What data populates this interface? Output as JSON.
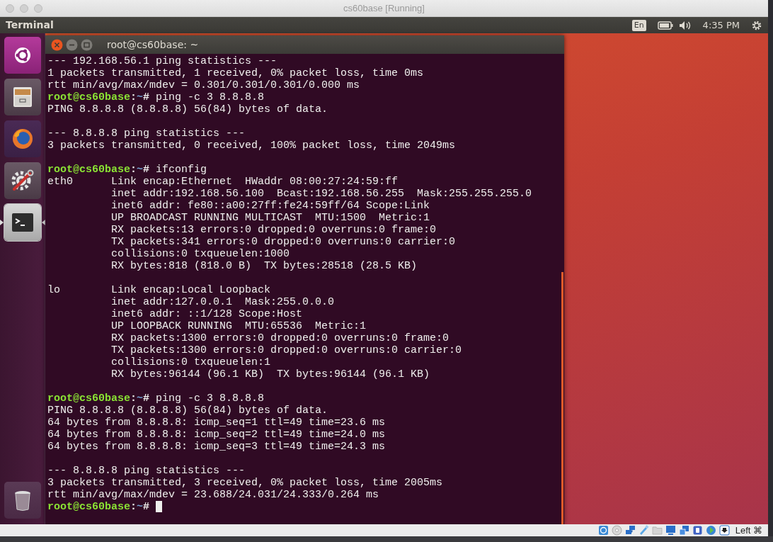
{
  "window": {
    "title": "cs60base [Running]"
  },
  "top_panel": {
    "app_name": "Terminal",
    "keyboard_layout": "En",
    "clock": "4:35 PM"
  },
  "launcher": {
    "items": [
      {
        "kind": "dash",
        "focused": false
      },
      {
        "kind": "files",
        "focused": false
      },
      {
        "kind": "browser",
        "focused": false
      },
      {
        "kind": "settings",
        "focused": false
      },
      {
        "kind": "terminal",
        "focused": true
      },
      {
        "kind": "trash",
        "focused": false
      }
    ]
  },
  "terminal": {
    "title": "root@cs60base: ~",
    "lines": [
      {
        "kind": "output",
        "text": "--- 192.168.56.1 ping statistics ---"
      },
      {
        "kind": "output",
        "text": "1 packets transmitted, 1 received, 0% packet loss, time 0ms"
      },
      {
        "kind": "output",
        "text": "rtt min/avg/max/mdev = 0.301/0.301/0.301/0.000 ms"
      },
      {
        "kind": "prompt",
        "user": "root@cs60base",
        "sep": ":",
        "path": "~",
        "symbol": "#",
        "command": "ping -c 3 8.8.8.8",
        "cursor": false
      },
      {
        "kind": "output",
        "text": "PING 8.8.8.8 (8.8.8.8) 56(84) bytes of data."
      },
      {
        "kind": "blank"
      },
      {
        "kind": "output",
        "text": "--- 8.8.8.8 ping statistics ---"
      },
      {
        "kind": "output",
        "text": "3 packets transmitted, 0 received, 100% packet loss, time 2049ms"
      },
      {
        "kind": "blank"
      },
      {
        "kind": "prompt",
        "user": "root@cs60base",
        "sep": ":",
        "path": "~",
        "symbol": "#",
        "command": "ifconfig",
        "cursor": false
      },
      {
        "kind": "output",
        "text": "eth0      Link encap:Ethernet  HWaddr 08:00:27:24:59:ff"
      },
      {
        "kind": "output",
        "text": "          inet addr:192.168.56.100  Bcast:192.168.56.255  Mask:255.255.255.0"
      },
      {
        "kind": "output",
        "text": "          inet6 addr: fe80::a00:27ff:fe24:59ff/64 Scope:Link"
      },
      {
        "kind": "output",
        "text": "          UP BROADCAST RUNNING MULTICAST  MTU:1500  Metric:1"
      },
      {
        "kind": "output",
        "text": "          RX packets:13 errors:0 dropped:0 overruns:0 frame:0"
      },
      {
        "kind": "output",
        "text": "          TX packets:341 errors:0 dropped:0 overruns:0 carrier:0"
      },
      {
        "kind": "output",
        "text": "          collisions:0 txqueuelen:1000"
      },
      {
        "kind": "output",
        "text": "          RX bytes:818 (818.0 B)  TX bytes:28518 (28.5 KB)"
      },
      {
        "kind": "blank"
      },
      {
        "kind": "output",
        "text": "lo        Link encap:Local Loopback"
      },
      {
        "kind": "output",
        "text": "          inet addr:127.0.0.1  Mask:255.0.0.0"
      },
      {
        "kind": "output",
        "text": "          inet6 addr: ::1/128 Scope:Host"
      },
      {
        "kind": "output",
        "text": "          UP LOOPBACK RUNNING  MTU:65536  Metric:1"
      },
      {
        "kind": "output",
        "text": "          RX packets:1300 errors:0 dropped:0 overruns:0 frame:0"
      },
      {
        "kind": "output",
        "text": "          TX packets:1300 errors:0 dropped:0 overruns:0 carrier:0"
      },
      {
        "kind": "output",
        "text": "          collisions:0 txqueuelen:1"
      },
      {
        "kind": "output",
        "text": "          RX bytes:96144 (96.1 KB)  TX bytes:96144 (96.1 KB)"
      },
      {
        "kind": "blank"
      },
      {
        "kind": "prompt",
        "user": "root@cs60base",
        "sep": ":",
        "path": "~",
        "symbol": "#",
        "command": "ping -c 3 8.8.8.8",
        "cursor": false
      },
      {
        "kind": "output",
        "text": "PING 8.8.8.8 (8.8.8.8) 56(84) bytes of data."
      },
      {
        "kind": "output",
        "text": "64 bytes from 8.8.8.8: icmp_seq=1 ttl=49 time=23.6 ms"
      },
      {
        "kind": "output",
        "text": "64 bytes from 8.8.8.8: icmp_seq=2 ttl=49 time=24.0 ms"
      },
      {
        "kind": "output",
        "text": "64 bytes from 8.8.8.8: icmp_seq=3 ttl=49 time=24.3 ms"
      },
      {
        "kind": "blank"
      },
      {
        "kind": "output",
        "text": "--- 8.8.8.8 ping statistics ---"
      },
      {
        "kind": "output",
        "text": "3 packets transmitted, 3 received, 0% packet loss, time 2005ms"
      },
      {
        "kind": "output",
        "text": "rtt min/avg/max/mdev = 23.688/24.031/24.333/0.264 ms"
      },
      {
        "kind": "prompt",
        "user": "root@cs60base",
        "sep": ":",
        "path": "~",
        "symbol": "#",
        "cursor": true
      }
    ]
  },
  "status_bar": {
    "host_key": "Left ⌘"
  }
}
